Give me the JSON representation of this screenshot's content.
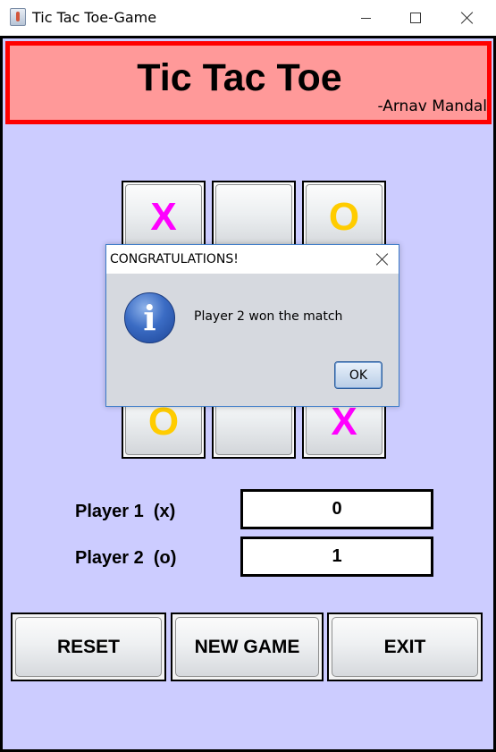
{
  "window": {
    "title": "Tic Tac Toe-Game",
    "icon": "java-coffee-icon"
  },
  "header": {
    "title": "Tic Tac Toe",
    "author": "-Arnav Mandal",
    "background": "#ff9999",
    "border_color": "#ff0000"
  },
  "board": {
    "cells": [
      "X",
      "",
      "O",
      "",
      "",
      "",
      "O",
      "",
      "X"
    ],
    "x_color": "#ff00ff",
    "o_color": "#ffcc00"
  },
  "scores": {
    "player1_label": "Player 1  (x)",
    "player1_score": "0",
    "player2_label": "Player 2  (o)",
    "player2_score": "1"
  },
  "buttons": {
    "reset": "RESET",
    "new_game": "NEW GAME",
    "exit": "EXIT"
  },
  "dialog": {
    "title": "CONGRATULATIONS!",
    "message": "Player 2 won the match",
    "ok_label": "OK",
    "icon": "info-icon",
    "info_glyph": "i"
  },
  "colors": {
    "content_background": "#ccccff"
  }
}
